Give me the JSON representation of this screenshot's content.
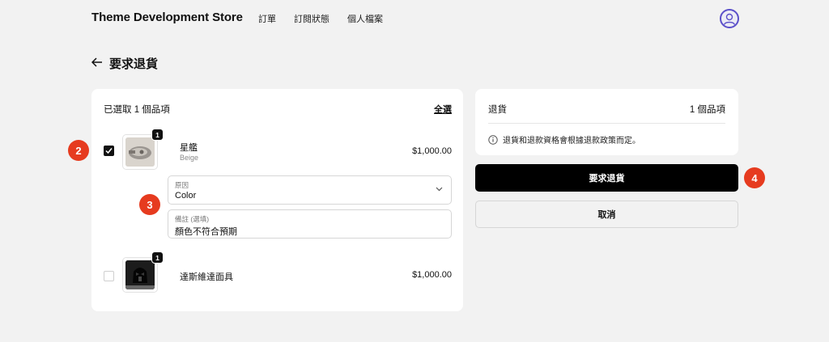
{
  "header": {
    "store_name": "Theme Development Store",
    "nav": [
      "訂單",
      "訂閱狀態",
      "個人檔案"
    ]
  },
  "page": {
    "title": "要求退貨"
  },
  "items_card": {
    "selected_text": "已選取 1 個品項",
    "select_all": "全選",
    "items": [
      {
        "name": "星艦",
        "variant": "Beige",
        "price": "$1,000.00",
        "quantity": "1",
        "checked": true
      },
      {
        "name": "達斯維達面具",
        "variant": "",
        "price": "$1,000.00",
        "quantity": "1",
        "checked": false
      }
    ],
    "reason": {
      "label": "原因",
      "value": "Color"
    },
    "note": {
      "label": "備註 (選填)",
      "value": "顏色不符合預期"
    }
  },
  "summary_card": {
    "label": "退貨",
    "count": "1 個品項",
    "notice": "退貨和退款資格會根據退款政策而定。"
  },
  "actions": {
    "request_return": "要求退貨",
    "cancel": "取消"
  },
  "steps": [
    "2",
    "3",
    "4"
  ],
  "colors": {
    "primary": "#000000",
    "step_badge": "#e63b1f",
    "avatar_ring": "#5b4fc9"
  }
}
